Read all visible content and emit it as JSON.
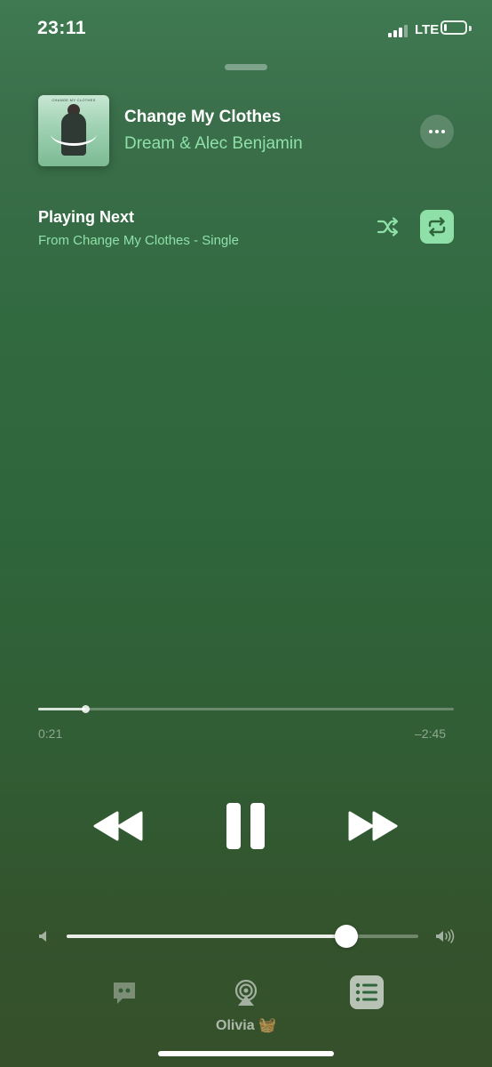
{
  "status_bar": {
    "time": "23:11",
    "network": "LTE",
    "signal_bars": 4,
    "signal_bars_filled": 3,
    "battery_level": 0.15,
    "icons": [
      "cellular-signal-icon",
      "battery-icon"
    ]
  },
  "now_playing": {
    "title": "Change My Clothes",
    "artist": "Dream & Alec Benjamin",
    "artwork_text": "CHANGE MY CLOTHES",
    "more_icon": "ellipsis-icon"
  },
  "queue": {
    "heading": "Playing Next",
    "source": "From Change My Clothes - Single",
    "shuffle_icon": "shuffle-icon",
    "repeat_icon": "repeat-icon",
    "repeat_active": true
  },
  "playback": {
    "elapsed": "0:21",
    "remaining": "–2:45",
    "progress": 0.114,
    "rewind_icon": "rewind-icon",
    "pause_icon": "pause-icon",
    "forward_icon": "fast-forward-icon"
  },
  "volume": {
    "level": 0.795,
    "low_icon": "speaker-low-icon",
    "high_icon": "speaker-high-icon"
  },
  "bottom_bar": {
    "lyrics_icon": "lyrics-icon",
    "airplay_icon": "airplay-icon",
    "device_name": "Olivia 🧺",
    "queue_icon": "queue-list-icon"
  },
  "colors": {
    "accent": "#8fe0a8",
    "background_top": "#3f7a52",
    "background_bottom": "#35502b"
  }
}
